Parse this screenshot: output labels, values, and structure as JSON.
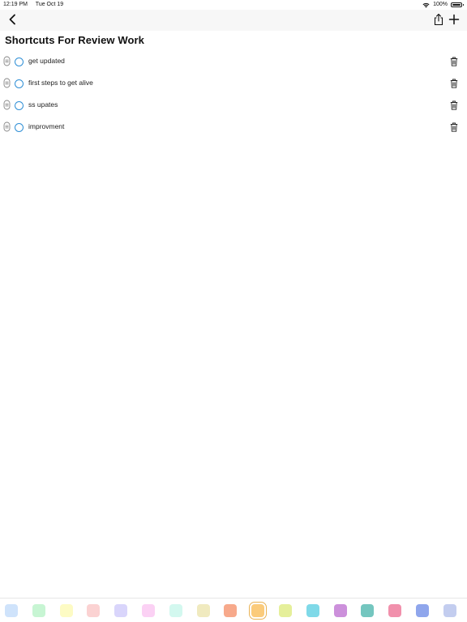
{
  "status_bar": {
    "time": "12:19 PM",
    "date": "Tue Oct 19",
    "battery": "100%",
    "wifi_icon": "wifi-icon",
    "battery_icon": "battery-icon"
  },
  "nav": {
    "back_icon": "chevron-left-icon",
    "share_icon": "share-icon",
    "add_icon": "plus-icon"
  },
  "page": {
    "title": "Shortcuts For Review Work"
  },
  "items": [
    {
      "label": "get updated"
    },
    {
      "label": "first steps to get alive"
    },
    {
      "label": "ss upates"
    },
    {
      "label": "improvment"
    }
  ],
  "colors": {
    "accent": "#2f8fd6",
    "swatches": [
      "#cfe3fb",
      "#c7f5d3",
      "#fdfbc4",
      "#fbd2d2",
      "#d9d5fb",
      "#fbd1f4",
      "#d3f8ef",
      "#f0eabf",
      "#f7a98b",
      "#fbcb7b",
      "#e5ef9a",
      "#7fd9e8",
      "#cc90db",
      "#74c6bf",
      "#f190ac",
      "#8fa6ec",
      "#c3cdef"
    ],
    "selected_swatch": 9
  }
}
